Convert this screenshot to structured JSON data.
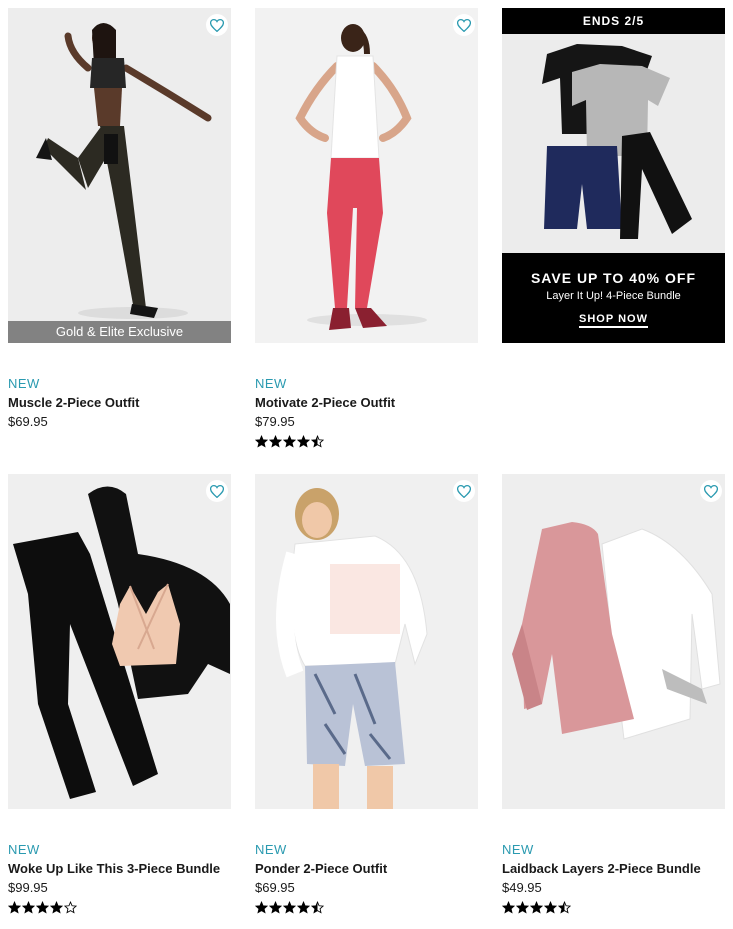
{
  "colors": {
    "accent": "#2a9ab0",
    "star": "#000000"
  },
  "products": [
    {
      "badge": "NEW",
      "name": "Muscle 2-Piece Outfit",
      "price": "$69.95",
      "exclusive": "Gold & Elite Exclusive",
      "rating": null
    },
    {
      "badge": "NEW",
      "name": "Motivate 2-Piece Outfit",
      "price": "$79.95",
      "rating": 4.5
    },
    {
      "badge": "NEW",
      "name": "Woke Up Like This 3-Piece Bundle",
      "price": "$99.95",
      "rating": 4
    },
    {
      "badge": "NEW",
      "name": "Ponder 2-Piece Outfit",
      "price": "$69.95",
      "rating": 4.5
    },
    {
      "badge": "NEW",
      "name": "Laidback Layers 2-Piece Bundle",
      "price": "$49.95",
      "rating": 4.5
    }
  ],
  "promo": {
    "top": "ENDS 2/5",
    "headline": "SAVE UP TO 40% OFF",
    "subline": "Layer It Up! 4-Piece Bundle",
    "cta": "SHOP NOW"
  },
  "icons": {
    "favorite": "heart-outline-icon",
    "star_full": "star-filled-icon",
    "star_half": "star-half-icon",
    "star_empty": "star-outline-icon"
  }
}
